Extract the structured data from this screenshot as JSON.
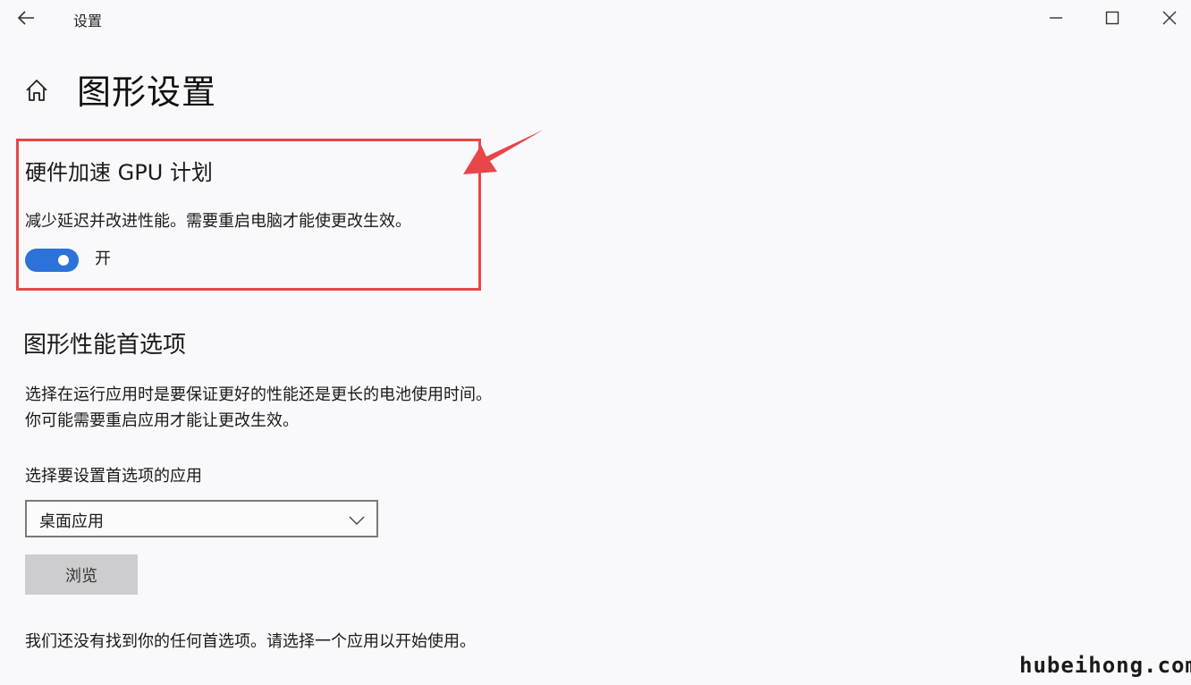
{
  "window": {
    "title": "设置"
  },
  "page": {
    "title": "图形设置"
  },
  "gpu_scheduling": {
    "heading": "硬件加速 GPU 计划",
    "description": "减少延迟并改进性能。需要重启电脑才能使更改生效。",
    "toggle_state": "开",
    "enabled": true
  },
  "graphics_preference": {
    "heading": "图形性能首选项",
    "description_line1": "选择在运行应用时是要保证更好的性能还是更长的电池使用时间。",
    "description_line2": "你可能需要重启应用才能让更改生效。",
    "select_label": "选择要设置首选项的应用",
    "dropdown_value": "桌面应用",
    "browse_label": "浏览",
    "empty_message": "我们还没有找到你的任何首选项。请选择一个应用以开始使用。"
  },
  "watermark": "hubeihong.com",
  "colors": {
    "accent": "#2c72d8",
    "highlight_border": "#e8464a",
    "background": "#f9f9fb"
  }
}
